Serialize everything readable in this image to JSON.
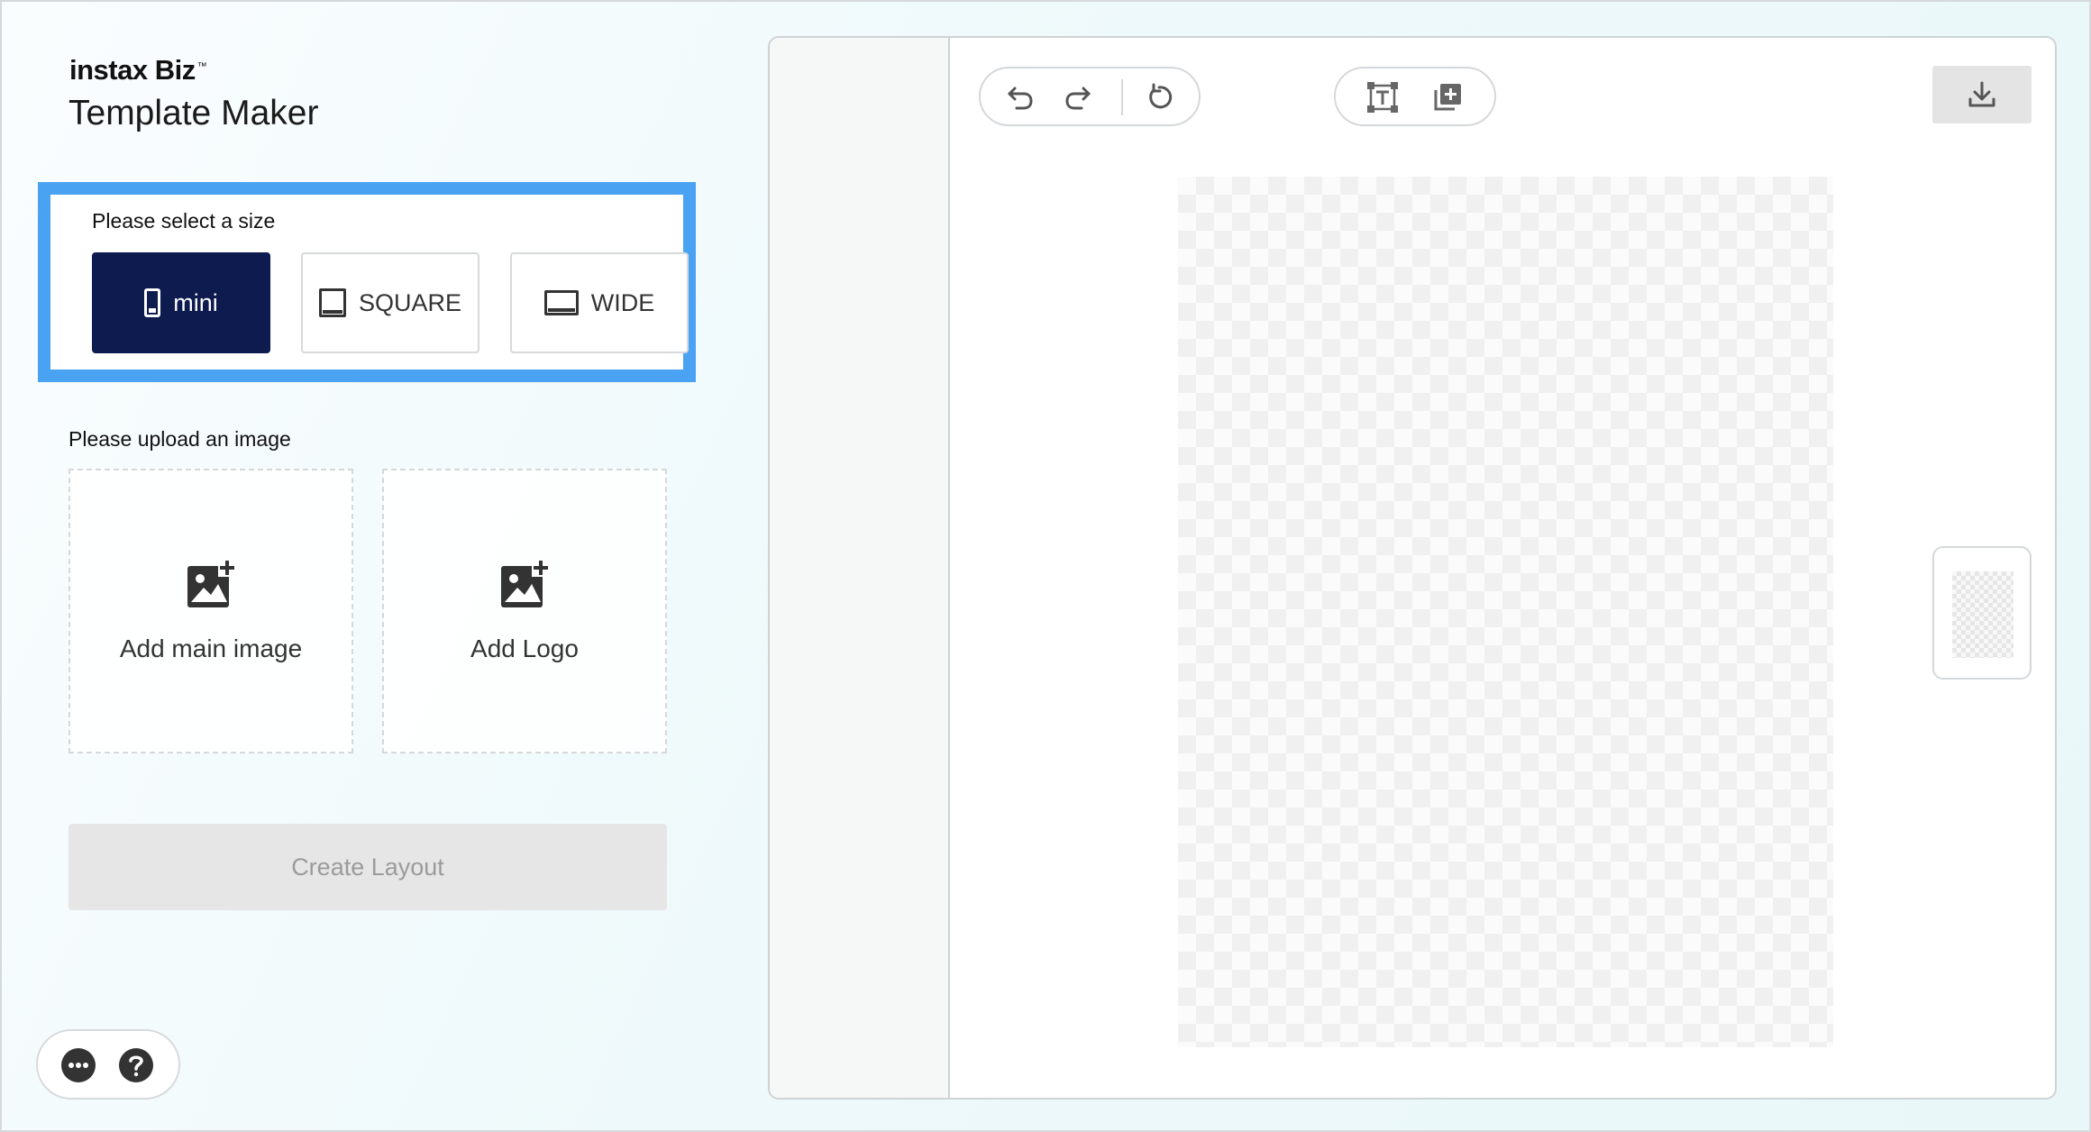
{
  "brand": {
    "name": "instax Biz",
    "trademark": "™"
  },
  "app_title": "Template Maker",
  "size_section": {
    "label": "Please select a size",
    "options": [
      {
        "label": "mini",
        "icon": "mini-portrait-icon",
        "selected": true
      },
      {
        "label": "SQUARE",
        "icon": "square-frame-icon",
        "selected": false
      },
      {
        "label": "WIDE",
        "icon": "wide-frame-icon",
        "selected": false
      }
    ],
    "highlight_color": "#4aa3f2",
    "selected_color": "#0d1b4f"
  },
  "upload_section": {
    "label": "Please upload an image",
    "main_image": {
      "label": "Add main image",
      "icon": "add-image-icon"
    },
    "logo": {
      "label": "Add Logo",
      "icon": "add-image-icon"
    }
  },
  "create_button": {
    "label": "Create Layout",
    "enabled": false
  },
  "footer_icons": [
    "more-icon",
    "help-icon"
  ],
  "editor_toolbar": {
    "history": [
      "undo-icon",
      "redo-icon",
      "reset-icon"
    ],
    "insert": [
      "add-text-icon",
      "add-layer-icon"
    ],
    "download": "download-icon"
  }
}
